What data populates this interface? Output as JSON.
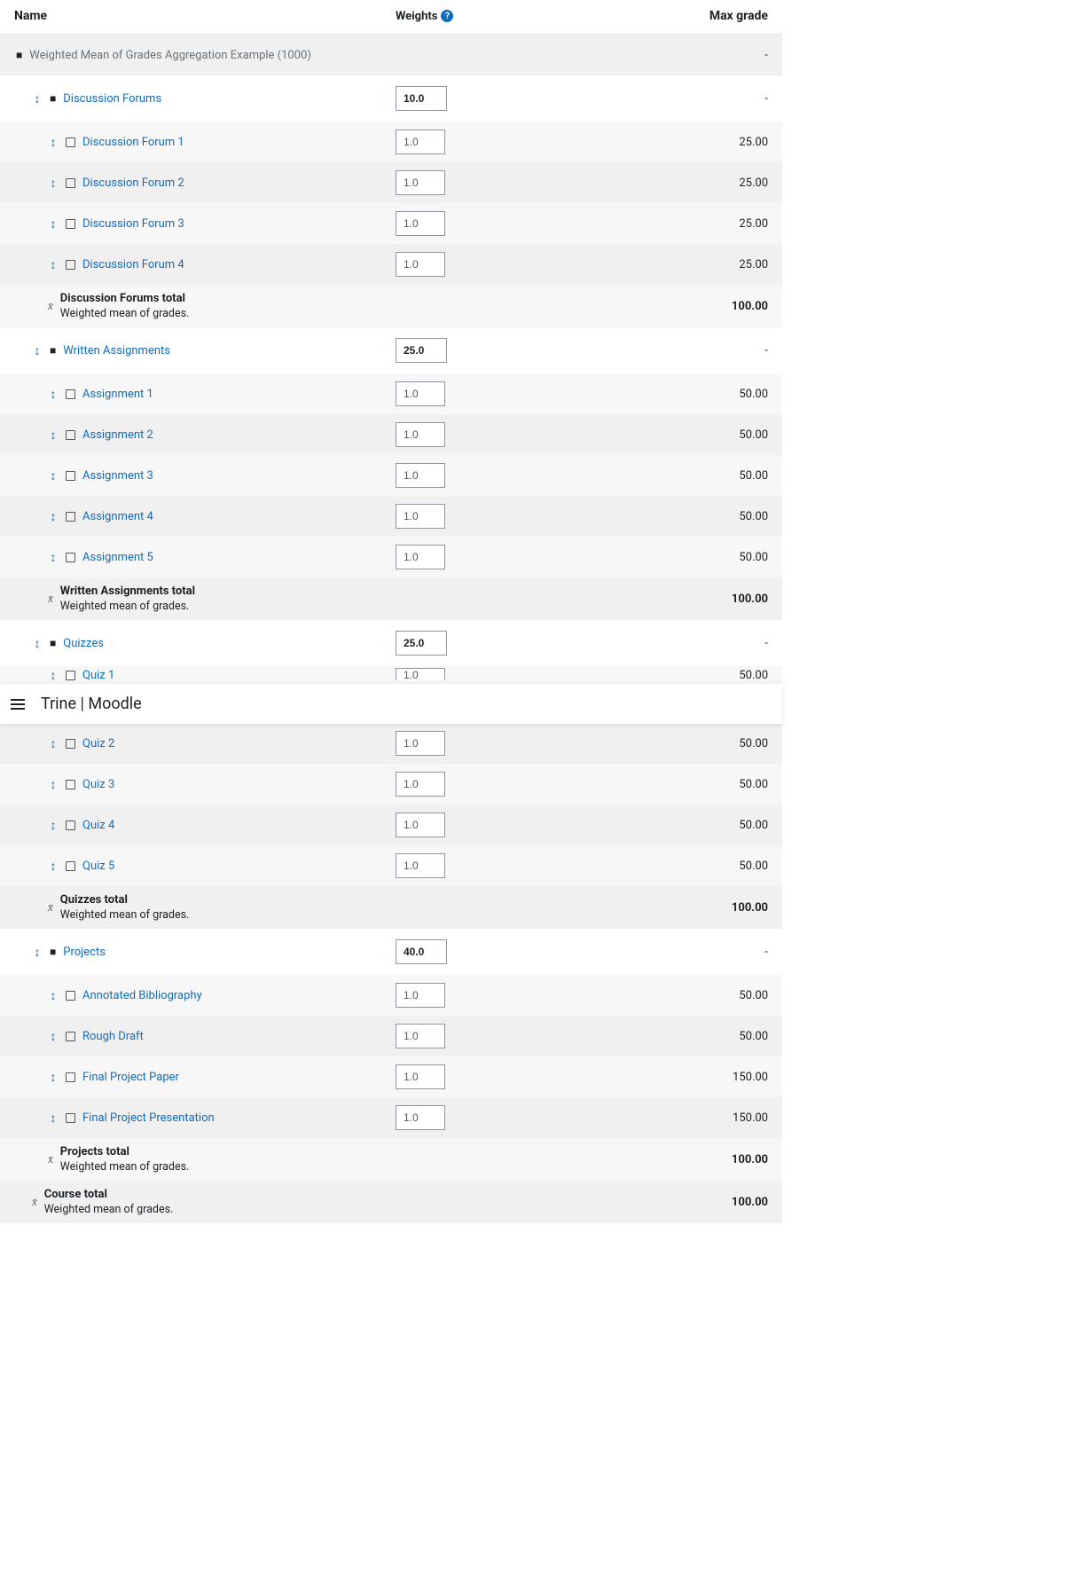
{
  "headers": {
    "name": "Name",
    "weights": "Weights",
    "max": "Max grade"
  },
  "sticky": {
    "title": "Trine | Moodle"
  },
  "top_category": {
    "name": "Weighted Mean of Grades Aggregation Example (1000)",
    "max": "-"
  },
  "categories": [
    {
      "name": "Discussion Forums",
      "weight": "10.0",
      "max": "-",
      "items": [
        {
          "name": "Discussion Forum 1",
          "weight": "1.0",
          "max": "25.00"
        },
        {
          "name": "Discussion Forum 2",
          "weight": "1.0",
          "max": "25.00"
        },
        {
          "name": "Discussion Forum 3",
          "weight": "1.0",
          "max": "25.00"
        },
        {
          "name": "Discussion Forum 4",
          "weight": "1.0",
          "max": "25.00"
        }
      ],
      "total": {
        "title": "Discussion Forums total",
        "sub": "Weighted mean of grades.",
        "max": "100.00"
      }
    },
    {
      "name": "Written Assignments",
      "weight": "25.0",
      "max": "-",
      "items": [
        {
          "name": "Assignment 1",
          "weight": "1.0",
          "max": "50.00"
        },
        {
          "name": "Assignment 2",
          "weight": "1.0",
          "max": "50.00"
        },
        {
          "name": "Assignment 3",
          "weight": "1.0",
          "max": "50.00"
        },
        {
          "name": "Assignment 4",
          "weight": "1.0",
          "max": "50.00"
        },
        {
          "name": "Assignment 5",
          "weight": "1.0",
          "max": "50.00"
        }
      ],
      "total": {
        "title": "Written Assignments total",
        "sub": "Weighted mean of grades.",
        "max": "100.00"
      }
    },
    {
      "name": "Quizzes",
      "weight": "25.0",
      "max": "-",
      "items": [
        {
          "name": "Quiz 1",
          "weight": "1.0",
          "max": "50.00"
        },
        {
          "name": "Quiz 2",
          "weight": "1.0",
          "max": "50.00"
        },
        {
          "name": "Quiz 3",
          "weight": "1.0",
          "max": "50.00"
        },
        {
          "name": "Quiz 4",
          "weight": "1.0",
          "max": "50.00"
        },
        {
          "name": "Quiz 5",
          "weight": "1.0",
          "max": "50.00"
        }
      ],
      "total": {
        "title": "Quizzes total",
        "sub": "Weighted mean of grades.",
        "max": "100.00"
      }
    },
    {
      "name": "Projects",
      "weight": "40.0",
      "max": "-",
      "items": [
        {
          "name": "Annotated Bibliography",
          "weight": "1.0",
          "max": "50.00"
        },
        {
          "name": "Rough Draft",
          "weight": "1.0",
          "max": "50.00"
        },
        {
          "name": "Final Project Paper",
          "weight": "1.0",
          "max": "150.00"
        },
        {
          "name": "Final Project Presentation",
          "weight": "1.0",
          "max": "150.00"
        }
      ],
      "total": {
        "title": "Projects total",
        "sub": "Weighted mean of grades.",
        "max": "100.00"
      }
    }
  ],
  "course_total": {
    "title": "Course total",
    "sub": "Weighted mean of grades.",
    "max": "100.00"
  }
}
